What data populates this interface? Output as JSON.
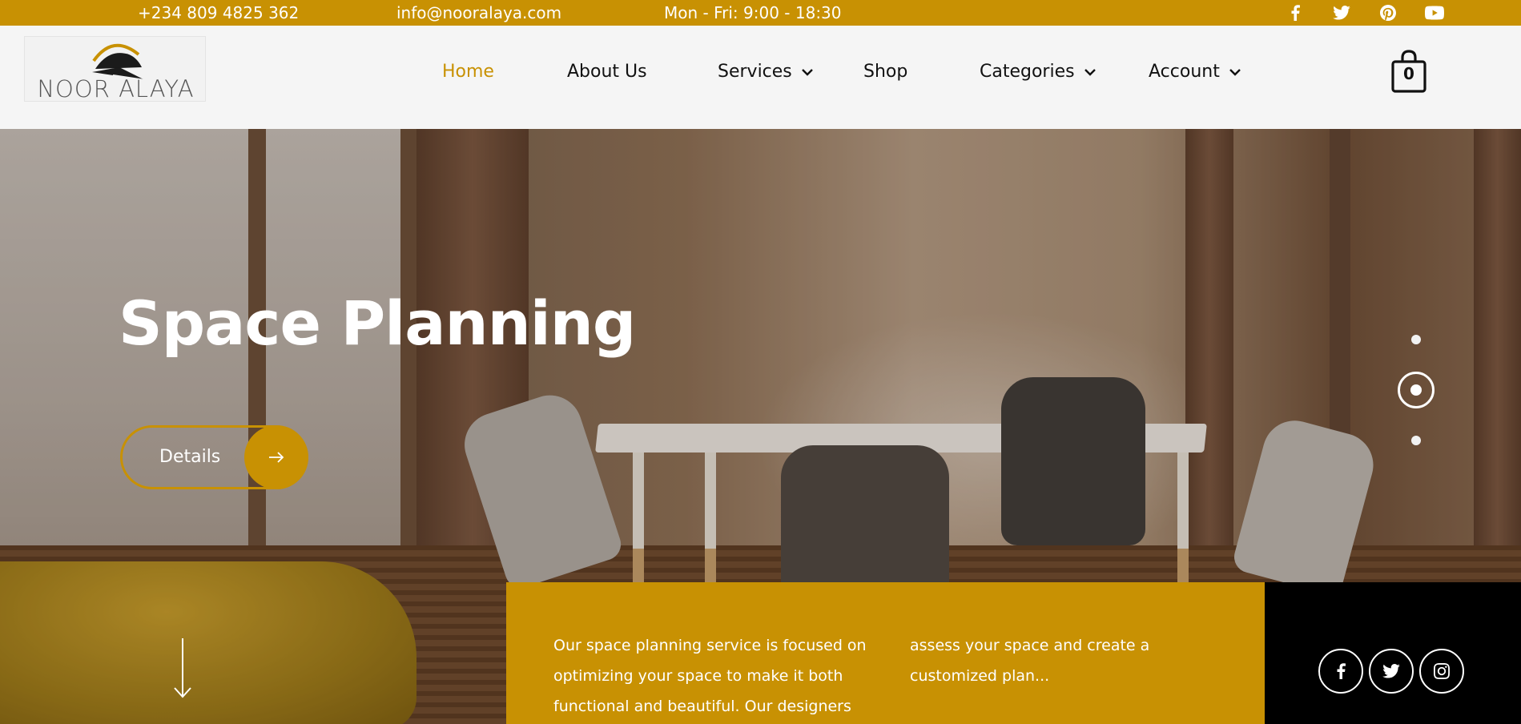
{
  "topbar": {
    "phone": "+234 809 4825 362",
    "email": "info@nooralaya.com",
    "hours": "Mon - Fri: 9:00 - 18:30",
    "social_icons": [
      "facebook-icon",
      "twitter-icon",
      "pinterest-icon",
      "youtube-icon"
    ]
  },
  "logo": {
    "text": "NOOR ALAYA"
  },
  "nav": {
    "home": "Home",
    "about": "About Us",
    "services": "Services",
    "shop": "Shop",
    "categories": "Categories",
    "account": "Account"
  },
  "cart": {
    "count": "0"
  },
  "hero": {
    "title": "Space Planning",
    "button_label": "Details",
    "slides_total": 3,
    "slide_active": 2
  },
  "info": {
    "col1": "Our space planning service is focused on optimizing your space to make it both functional and beautiful. Our designers will",
    "col2": "assess your space and create a customized plan..."
  },
  "social_panel": [
    "facebook-icon",
    "twitter-icon",
    "instagram-icon"
  ],
  "colors": {
    "accent": "#c89103",
    "dark": "#000000",
    "header_bg": "#f5f5f5"
  }
}
